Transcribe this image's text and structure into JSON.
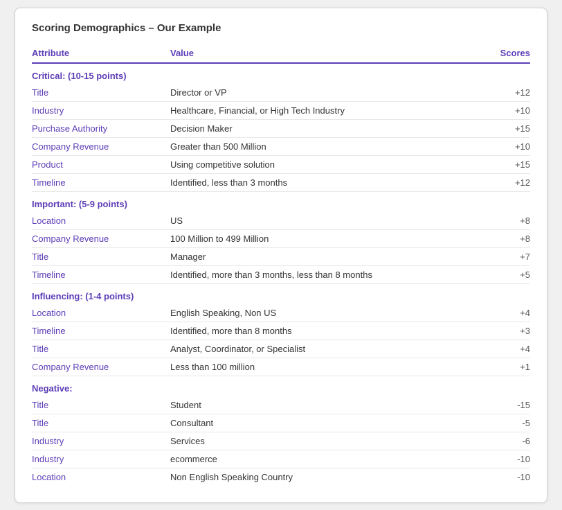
{
  "card": {
    "title": "Scoring Demographics – Our Example",
    "headers": {
      "attribute": "Attribute",
      "value": "Value",
      "scores": "Scores"
    },
    "sections": [
      {
        "label": "Critical: (10-15 points)",
        "rows": [
          {
            "attribute": "Title",
            "value": "Director or VP",
            "score": "+12"
          },
          {
            "attribute": "Industry",
            "value": "Healthcare, Financial, or High Tech Industry",
            "score": "+10"
          },
          {
            "attribute": "Purchase Authority",
            "value": "Decision Maker",
            "score": "+15"
          },
          {
            "attribute": "Company Revenue",
            "value": "Greater than 500 Million",
            "score": "+10"
          },
          {
            "attribute": "Product",
            "value": "Using competitive solution",
            "score": "+15"
          },
          {
            "attribute": "Timeline",
            "value": "Identified, less than 3 months",
            "score": "+12"
          }
        ]
      },
      {
        "label": "Important: (5-9 points)",
        "rows": [
          {
            "attribute": "Location",
            "value": "US",
            "score": "+8"
          },
          {
            "attribute": "Company Revenue",
            "value": "100 Million to 499 Million",
            "score": "+8"
          },
          {
            "attribute": "Title",
            "value": "Manager",
            "score": "+7"
          },
          {
            "attribute": "Timeline",
            "value": "Identified, more than 3 months, less than 8 months",
            "score": "+5"
          }
        ]
      },
      {
        "label": "Influencing: (1-4 points)",
        "rows": [
          {
            "attribute": "Location",
            "value": "English Speaking, Non US",
            "score": "+4"
          },
          {
            "attribute": "Timeline",
            "value": "Identified, more than 8 months",
            "score": "+3"
          },
          {
            "attribute": "Title",
            "value": "Analyst, Coordinator, or Specialist",
            "score": "+4"
          },
          {
            "attribute": "Company Revenue",
            "value": "Less than 100 million",
            "score": "+1"
          }
        ]
      },
      {
        "label": "Negative:",
        "rows": [
          {
            "attribute": "Title",
            "value": "Student",
            "score": "-15"
          },
          {
            "attribute": "Title",
            "value": "Consultant",
            "score": "-5"
          },
          {
            "attribute": "Industry",
            "value": "Services",
            "score": "-6"
          },
          {
            "attribute": "Industry",
            "value": "ecommerce",
            "score": "-10"
          },
          {
            "attribute": "Location",
            "value": "Non English Speaking Country",
            "score": "-10"
          }
        ]
      }
    ]
  }
}
